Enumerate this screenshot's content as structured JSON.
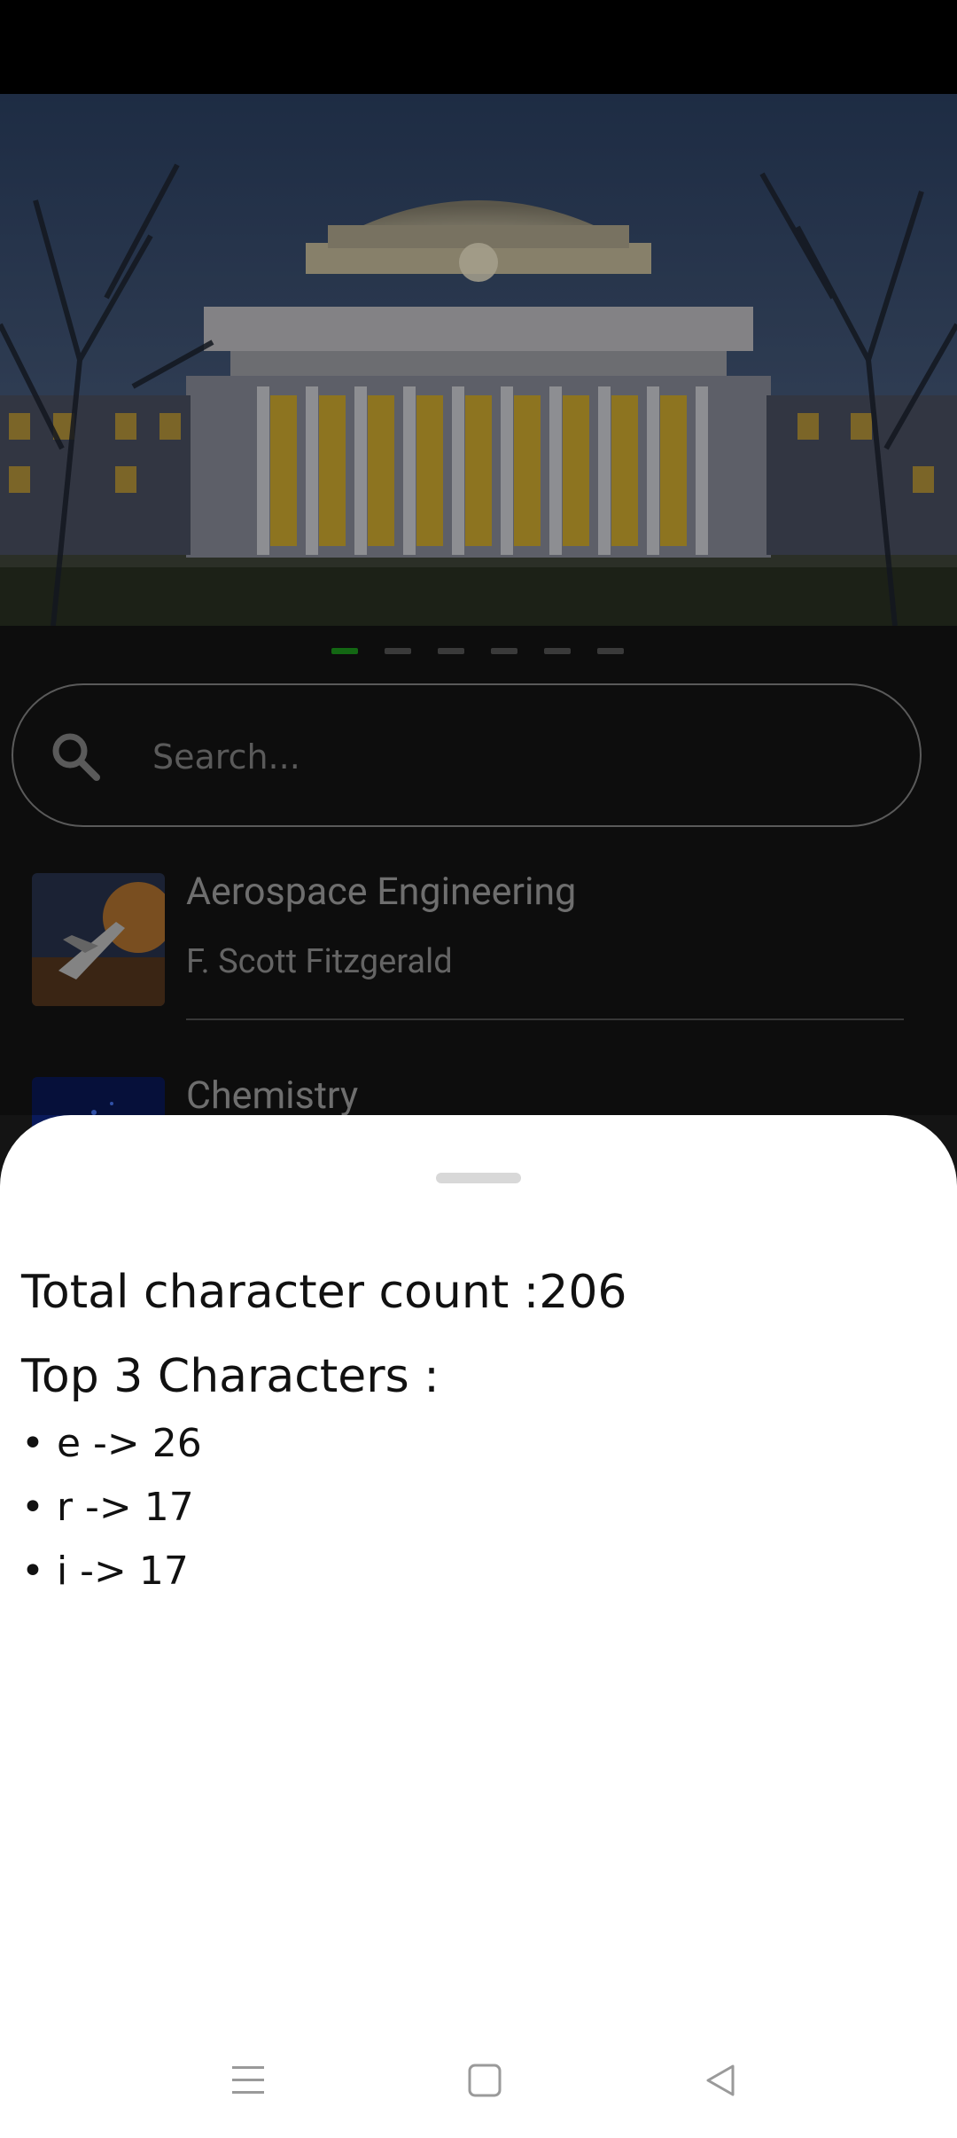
{
  "hero": {
    "image": "university-dome-building",
    "carousel_dot_count": 6,
    "active_index": 0,
    "active_color": "#1e9e1e"
  },
  "search": {
    "placeholder": "Search...",
    "icon": "search-icon"
  },
  "list": {
    "items": [
      {
        "title": "Aerospace Engineering",
        "subtitle": "F. Scott Fitzgerald",
        "thumbnail": "spacecraft-image"
      },
      {
        "title": "Chemistry",
        "subtitle": "",
        "thumbnail": "blue-abstract-image"
      }
    ]
  },
  "sheet": {
    "total_label": "Total character count :206",
    "top_label": "Top 3 Characters :",
    "bullets": [
      "• e -> 26",
      "• r -> 17",
      "• i -> 17"
    ]
  },
  "nav": {
    "menu_icon": "menu-icon",
    "home_icon": "home-square-icon",
    "back_icon": "back-triangle-icon"
  }
}
